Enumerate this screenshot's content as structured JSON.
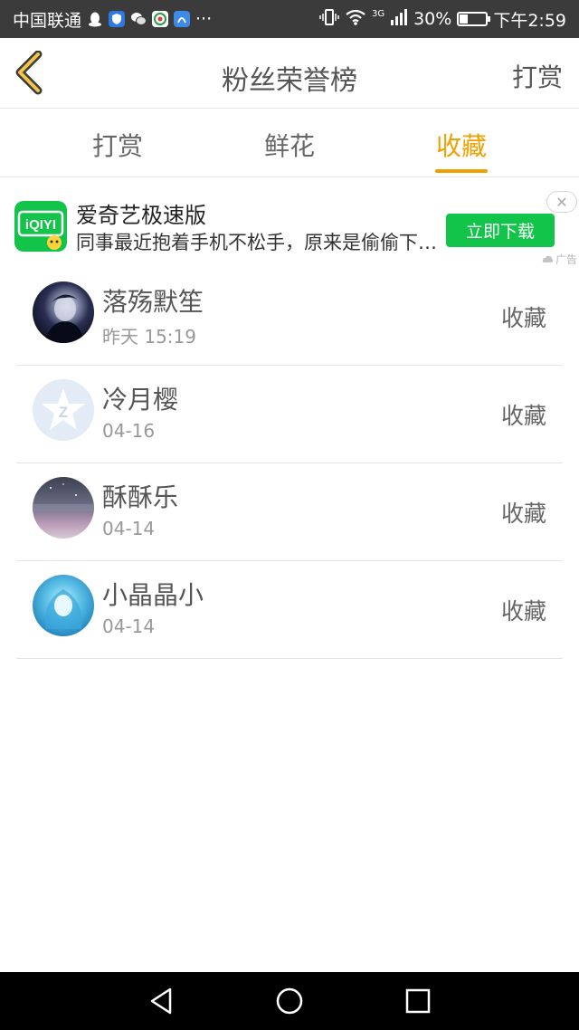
{
  "status_bar": {
    "carrier": "中国联通",
    "more": "···",
    "network": "3G",
    "battery": "30%",
    "battery_level": 0.3,
    "time": "下午2:59"
  },
  "header": {
    "title": "粉丝荣誉榜",
    "right_action": "打赏"
  },
  "tabs": [
    {
      "label": "打赏",
      "active": false
    },
    {
      "label": "鲜花",
      "active": false
    },
    {
      "label": "收藏",
      "active": true
    }
  ],
  "ad": {
    "title": "爱奇艺极速版",
    "description": "同事最近抱着手机不松手，原来是偷偷下载了",
    "button": "立即下载",
    "tag": "广告",
    "logo_text": "iQIYI",
    "close_glyph": "✕"
  },
  "list": [
    {
      "name": "落殇默笙",
      "time": "昨天 15:19",
      "action": "收藏"
    },
    {
      "name": "冷月樱",
      "time": "04-16",
      "action": "收藏"
    },
    {
      "name": "酥酥乐",
      "time": "04-14",
      "action": "收藏"
    },
    {
      "name": "小晶晶小",
      "time": "04-14",
      "action": "收藏"
    }
  ],
  "colors": {
    "accent": "#f0a000",
    "ad_green": "#12c44a",
    "status_bar": "#3b3b3b"
  },
  "icons": {
    "back": "chevron-left-icon",
    "nav_back": "triangle-back-icon",
    "nav_home": "circle-home-icon",
    "nav_recent": "square-recent-icon"
  }
}
